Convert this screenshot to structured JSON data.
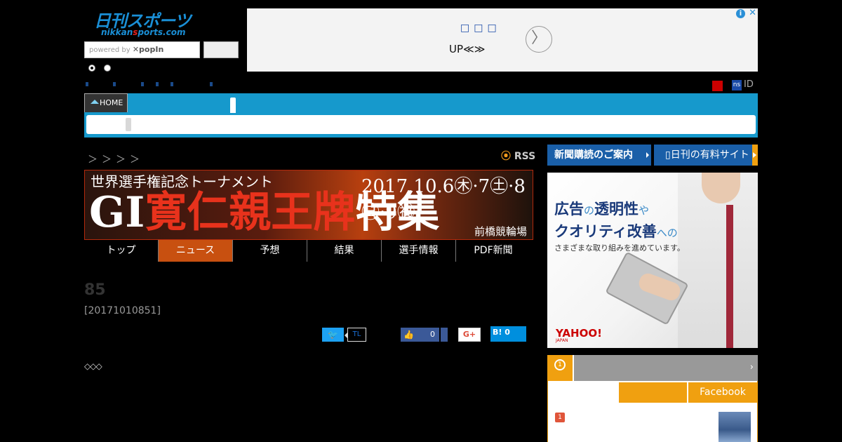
{
  "header": {
    "logo_main": "日刊スポーツ",
    "logo_sub_a": "nikkan",
    "logo_sub_b": "s",
    "logo_sub_c": "ports.com",
    "search_placeholder_prefix": "powered by",
    "search_placeholder_brand": "✕popIn",
    "id_label": "ID",
    "ns_badge": "ns"
  },
  "ad_top": {
    "dots": "□□□",
    "text": "UP≪≫",
    "info_icon": "i",
    "close_icon": "✕",
    "next_icon": "〉"
  },
  "nav": {
    "home_label": "HOME"
  },
  "content": {
    "breadcrumb": "＞＞＞＞",
    "rss_label": "RSS",
    "banner": {
      "subtitle": "世界選手権記念トーナメント",
      "title_a": "GI",
      "title_b": "寛仁親王牌",
      "title_c": "特集",
      "date": "2017.10.6㊍·7㊏·8㊐·9㊗",
      "venue": "前橋競輪場"
    },
    "tabs": [
      "トップ",
      "ニュース",
      "予想",
      "結果",
      "選手情報",
      "PDF新聞"
    ],
    "active_tab": 1,
    "article_title": "85",
    "article_id": "[20171010851]",
    "diamonds": "◇◇◇"
  },
  "share": {
    "tweet_icon": "twitter-bird",
    "tl_label": "TL",
    "fb_count": "0",
    "gplus_label": "G+",
    "hatena_label": "B!",
    "hatena_count": "0"
  },
  "sidebar": {
    "subscribe_label": "新聞購読のご案内",
    "paid_label": "日刊の有料サイト",
    "ad": {
      "line1_a": "広告",
      "line1_b": "の",
      "line1_c": "透明性",
      "line1_d": "や",
      "line2_a": "クオリティ改善",
      "line2_b": "への",
      "line3": "さまざまな取り組みを進めています。",
      "brand": "YAHOO!",
      "brand_sub": "JAPAN"
    },
    "ranking": {
      "medal": "1",
      "chevron": "›",
      "tab_b": "Facebook",
      "first_rank": "1"
    }
  },
  "colors": {
    "nav_blue": "#1699cc",
    "active_tab": "#c85010",
    "ranking_orange": "#f0a010",
    "sidebar_button": "#1a5fa8"
  }
}
